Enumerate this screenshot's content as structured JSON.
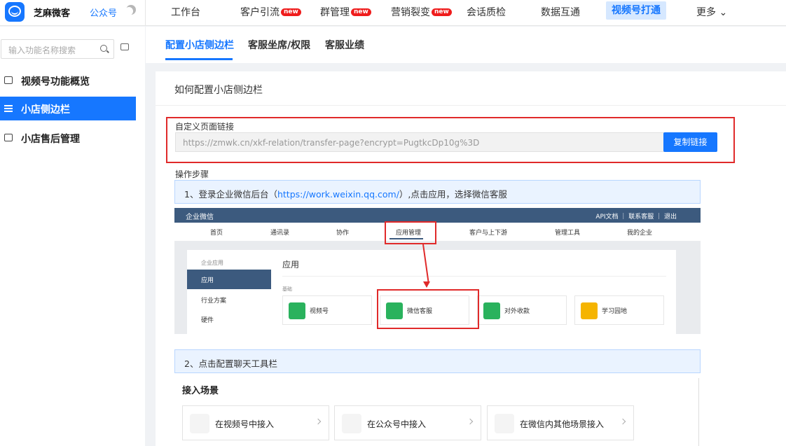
{
  "header": {
    "brand": "芝麻微客",
    "account_tag": "公众号",
    "nav": [
      {
        "label": "工作台"
      },
      {
        "label": "客户引流",
        "badge": "new"
      },
      {
        "label": "群管理",
        "badge": "new"
      },
      {
        "label": "营销裂变",
        "badge": "new"
      },
      {
        "label": "会话质检"
      },
      {
        "label": "数据互通"
      },
      {
        "label": "视频号打通",
        "active": true
      },
      {
        "label": "更多 ⌄"
      }
    ]
  },
  "sidebar": {
    "search_placeholder": "输入功能名称搜索",
    "items": [
      {
        "label": "视频号功能概览"
      },
      {
        "label": "小店侧边栏",
        "active": true
      },
      {
        "label": "小店售后管理"
      }
    ]
  },
  "tabs": [
    {
      "label": "配置小店侧边栏",
      "active": true
    },
    {
      "label": "客服坐席/权限"
    },
    {
      "label": "客服业绩"
    }
  ],
  "card": {
    "title": "如何配置小店侧边栏",
    "url_label": "自定义页面链接",
    "url_value": "https://zmwk.cn/xkf-relation/transfer-page?encrypt=PugtkcDp10g%3D",
    "copy_button": "复制链接",
    "steps_label": "操作步骤",
    "step1": {
      "prefix": "1、登录企业微信后台（",
      "link": "https://work.weixin.qq.com/",
      "suffix": "）,点击应用，选择微信客服"
    },
    "step2": "2、点击配置聊天工具栏",
    "scene_title": "接入场景",
    "scenes": [
      {
        "label": "在视频号中接入",
        "icon": "channels-icon"
      },
      {
        "label": "在公众号中接入",
        "icon": "official-account-icon"
      },
      {
        "label": "在微信内其他场景接入",
        "icon": "wechat-icon"
      }
    ]
  },
  "screenshot": {
    "brand": "企业微信",
    "top_right": "API文档 ｜ 联系客服 ｜ 退出",
    "nav": [
      "首页",
      "通讯录",
      "协作",
      "应用管理",
      "客户与上下游",
      "管理工具",
      "我的企业"
    ],
    "left_header": "企业应用",
    "left_items": [
      "应用",
      "行业方案",
      "硬件"
    ],
    "main_title": "应用",
    "sub_label": "基础",
    "apps": [
      {
        "name": "视频号",
        "color": "#2ab25d"
      },
      {
        "name": "微信客服",
        "color": "#2ab25d"
      },
      {
        "name": "对外收款",
        "color": "#2ab25d"
      },
      {
        "name": "学习园地",
        "color": "#f5b400"
      }
    ]
  }
}
